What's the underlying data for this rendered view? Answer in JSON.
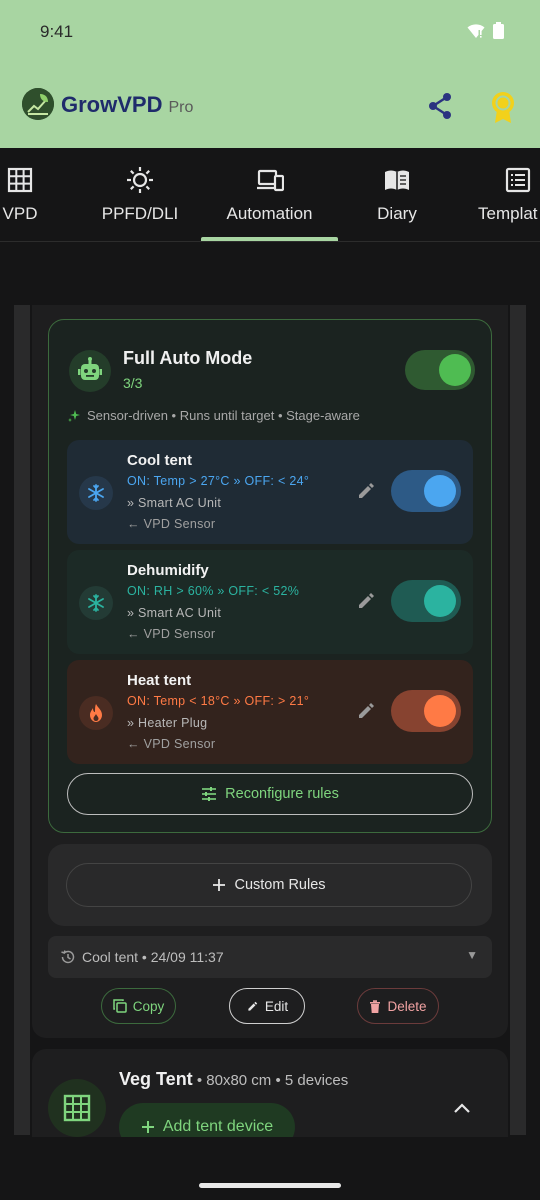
{
  "status_bar": {
    "time": "9:41"
  },
  "app_bar": {
    "title": "GrowVPD",
    "pro_label": "Pro",
    "icons": [
      "app-logo",
      "share-icon",
      "award-badge-icon"
    ]
  },
  "tabs": [
    {
      "label": "VPD",
      "icon": "grid-icon"
    },
    {
      "label": "PPFD/DLI",
      "icon": "sun-icon"
    },
    {
      "label": "Automation",
      "icon": "devices-icon",
      "selected": true
    },
    {
      "label": "Diary",
      "icon": "book-icon"
    },
    {
      "label": "Templat",
      "icon": "list-icon"
    }
  ],
  "automation": {
    "title": "Full Auto Mode",
    "count": "3/3",
    "enabled": true,
    "description": "Sensor-driven • Runs until target • Stage-aware",
    "rules": [
      {
        "title": "Cool tent",
        "condition": "ON: Temp > 27°C  »  OFF: < 24°",
        "device": "» Smart AC Unit",
        "sensor": "← VPD Sensor",
        "enabled": true,
        "icon": "snowflake-icon",
        "accent": "#4ba6f0"
      },
      {
        "title": "Dehumidify",
        "condition": "ON: RH > 60%  »  OFF: < 52%",
        "device": "» Smart AC Unit",
        "sensor": "← VPD Sensor",
        "enabled": true,
        "icon": "snowflake-icon",
        "accent": "#2bb3a0"
      },
      {
        "title": "Heat tent",
        "condition": "ON: Temp < 18°C  »  OFF: > 21°",
        "device": "» Heater Plug",
        "sensor": "← VPD Sensor",
        "enabled": true,
        "icon": "flame-icon",
        "accent": "#ff7a45"
      }
    ],
    "reconfigure_label": "Reconfigure rules"
  },
  "custom_rules_label": "Custom Rules",
  "history": {
    "text": "Cool tent • 24/09 11:37"
  },
  "actions": {
    "copy": "Copy",
    "edit": "Edit",
    "delete": "Delete"
  },
  "veg_tent": {
    "name": "Veg Tent",
    "meta": " • 80x80 cm • 5 devices",
    "add_device_label": "Add tent device"
  },
  "colors": {
    "header_bg": "#a8d5a2",
    "accent_green": "#7fd57e",
    "background": "#151516"
  }
}
